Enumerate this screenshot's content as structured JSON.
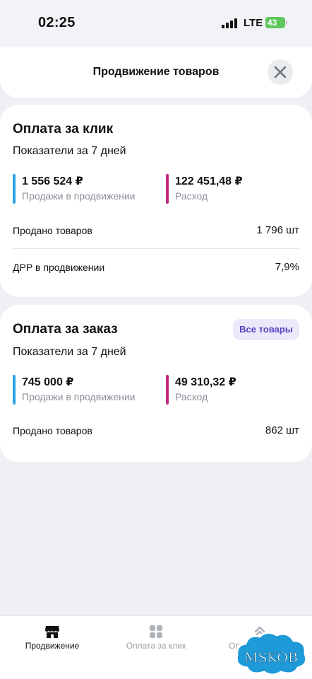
{
  "status_bar": {
    "time": "02:25",
    "network": "LTE",
    "battery": "43"
  },
  "header": {
    "title": "Продвижение товаров",
    "close_icon": "close-icon"
  },
  "card_click": {
    "title": "Оплата за клик",
    "subtitle": "Показатели за 7 дней",
    "sales_value": "1 556 524 ₽",
    "sales_label": "Продажи в продвижении",
    "expense_value": "122 451,48 ₽",
    "expense_label": "Расход",
    "sold_label": "Продано товаров",
    "sold_value": "1 796 шт",
    "drr_label": "ДРР в продвижении",
    "drr_value": "7,9%"
  },
  "card_order": {
    "title": "Оплата за заказ",
    "badge": "Все товары",
    "subtitle": "Показатели за 7 дней",
    "sales_value": "745 000 ₽",
    "sales_label": "Продажи в продвижении",
    "expense_value": "49 310,32 ₽",
    "expense_label": "Расход",
    "sold_label": "Продано товаров",
    "sold_value": "862 шт"
  },
  "tabs": [
    {
      "label": "Продвижение",
      "icon": "storefront-icon",
      "active": true
    },
    {
      "label": "Оплата за клик",
      "icon": "grid-icon",
      "active": false
    },
    {
      "label": "Опл",
      "icon": "chevrons-up-icon",
      "active": false
    }
  ],
  "watermark": {
    "text": "MSKOB"
  },
  "colors": {
    "sales_bar": "#27a4e0",
    "expense_bar": "#c0267f",
    "badge_bg": "#ece9fb",
    "badge_text": "#5a3fc0"
  }
}
